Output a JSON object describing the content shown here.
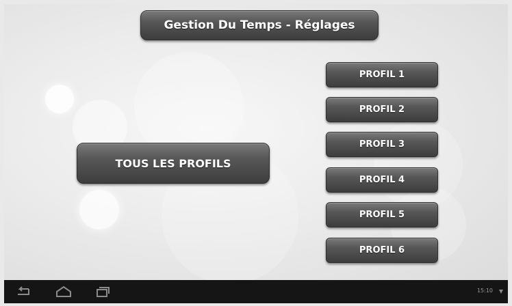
{
  "header": {
    "title": "Gestion Du Temps - Réglages"
  },
  "main": {
    "all_profiles_label": "TOUS LES PROFILS",
    "profiles": [
      {
        "label": "PROFIL 1"
      },
      {
        "label": "PROFIL 2"
      },
      {
        "label": "PROFIL 3"
      },
      {
        "label": "PROFIL 4"
      },
      {
        "label": "PROFIL 5"
      },
      {
        "label": "PROFIL 6"
      }
    ]
  },
  "status_bar": {
    "time": "15:10",
    "icons": [
      "back-icon",
      "home-icon",
      "recent-apps-icon",
      "wifi-icon"
    ]
  },
  "colors": {
    "button_dark": "#4a4a4a",
    "navbar": "#151515"
  }
}
